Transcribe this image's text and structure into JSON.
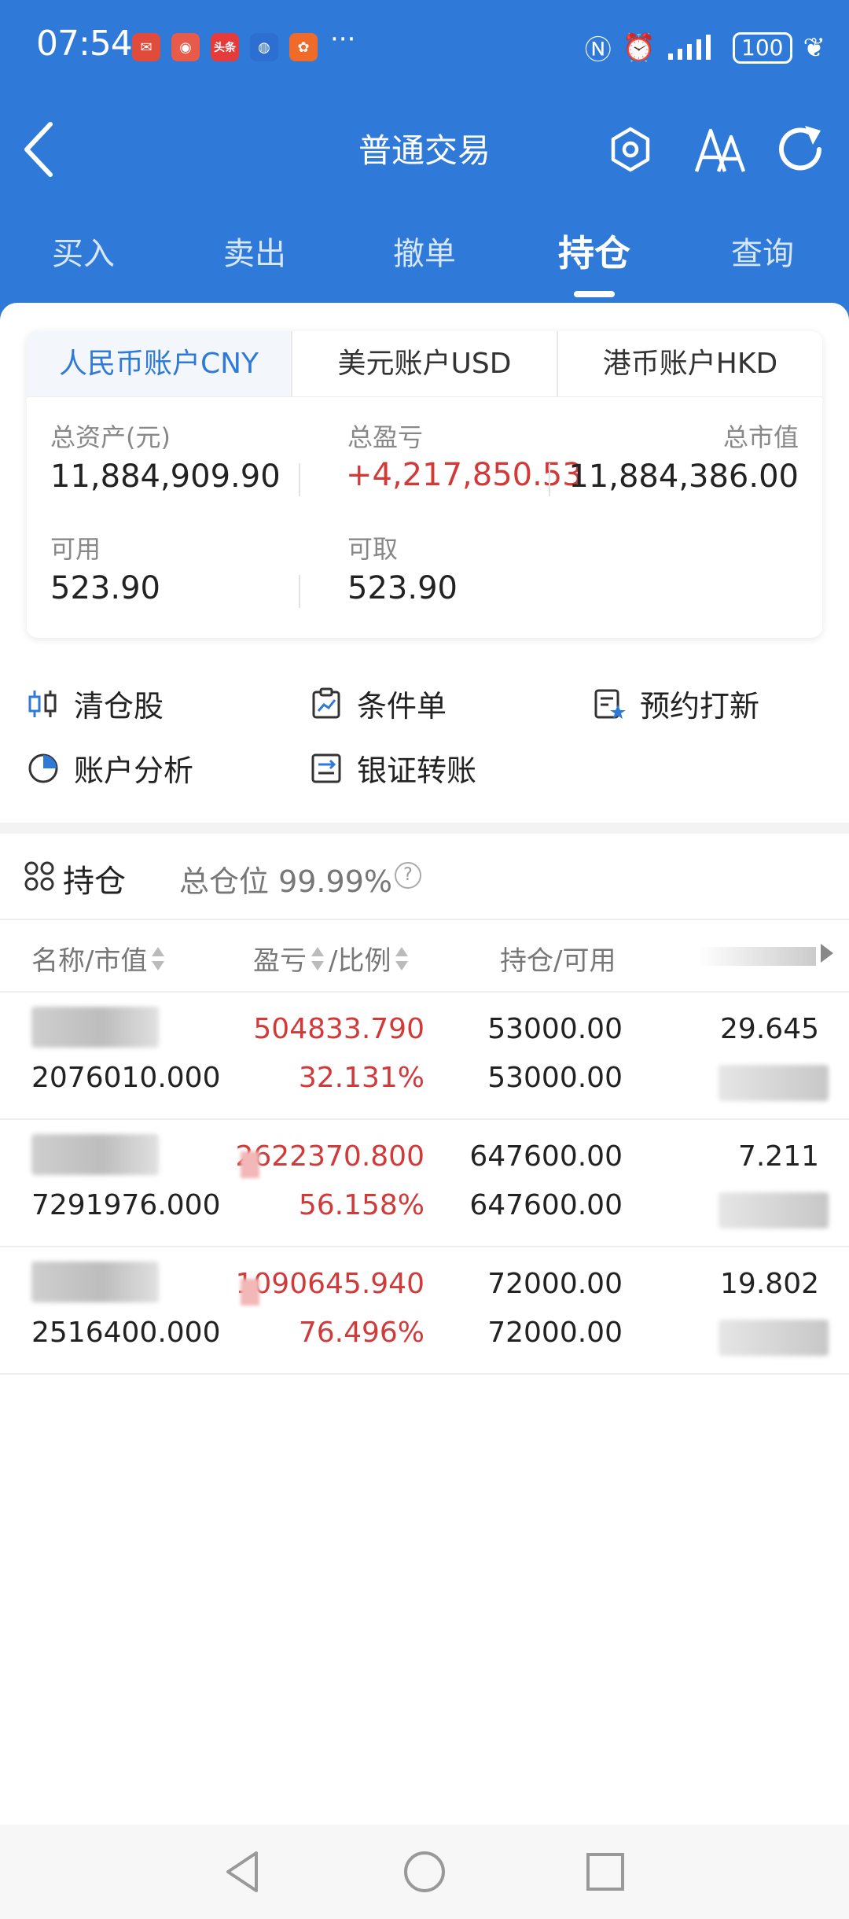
{
  "status_bar": {
    "time": "07:54",
    "notification_icons": [
      "app-icon",
      "app-icon",
      "toutiao-icon",
      "app-icon",
      "app-icon"
    ],
    "more": "···",
    "battery": "100"
  },
  "nav": {
    "title": "普通交易"
  },
  "tabs": [
    {
      "label": "买入"
    },
    {
      "label": "卖出"
    },
    {
      "label": "撤单"
    },
    {
      "label": "持仓"
    },
    {
      "label": "查询"
    }
  ],
  "currency_tabs": [
    {
      "label": "人民币账户CNY"
    },
    {
      "label": "美元账户USD"
    },
    {
      "label": "港币账户HKD"
    }
  ],
  "summary": {
    "total_assets_label": "总资产(元)",
    "total_assets": "11,884,909.90",
    "total_pnl_label": "总盈亏",
    "total_pnl": "+4,217,850.53",
    "market_value_label": "总市值",
    "market_value": "11,884,386.00",
    "available_label": "可用",
    "available": "523.90",
    "withdrawable_label": "可取",
    "withdrawable": "523.90"
  },
  "quick_actions": [
    {
      "label": "清仓股",
      "icon": "candlestick-icon"
    },
    {
      "label": "条件单",
      "icon": "clipboard-chart-icon"
    },
    {
      "label": "预约打新",
      "icon": "document-star-icon"
    },
    {
      "label": "账户分析",
      "icon": "pie-chart-icon"
    },
    {
      "label": "银证转账",
      "icon": "transfer-icon"
    }
  ],
  "holdings": {
    "title": "持仓",
    "position_ratio": "总仓位 99.99%",
    "columns": {
      "name": "名称/市值",
      "pnl": "盈亏",
      "ratio": "/比例",
      "qty": "持仓/可用"
    },
    "rows": [
      {
        "market_value": "2076010.000",
        "pnl": "504833.790",
        "pnl_pct": "32.131%",
        "qty": "53000.00",
        "available": "53000.00",
        "price": "29.645"
      },
      {
        "market_value": "7291976.000",
        "pnl": "2622370.800",
        "pnl_pct": "56.158%",
        "qty": "647600.00",
        "available": "647600.00",
        "price": "7.211"
      },
      {
        "market_value": "2516400.000",
        "pnl": "1090645.940",
        "pnl_pct": "76.496%",
        "qty": "72000.00",
        "available": "72000.00",
        "price": "19.802"
      }
    ]
  },
  "colors": {
    "brand_blue": "#2f7ad9",
    "loss_gain_red": "#d23a3a"
  }
}
